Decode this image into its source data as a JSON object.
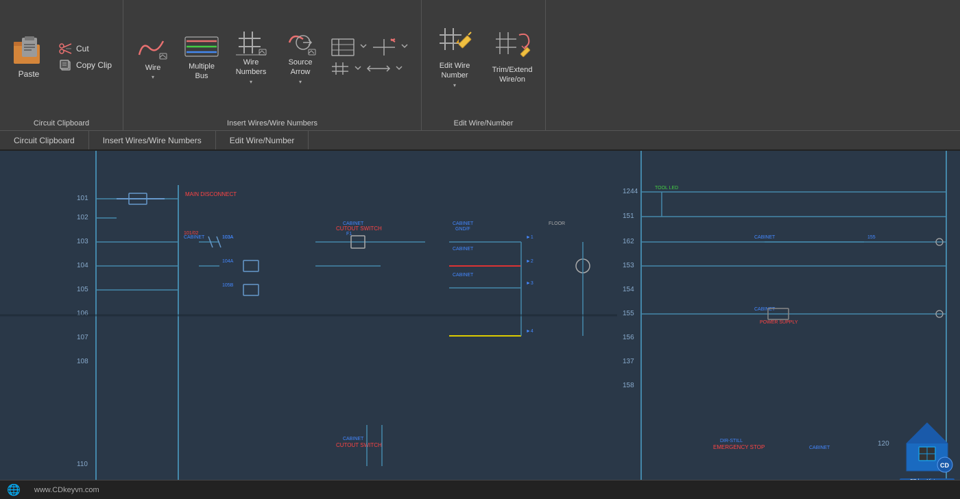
{
  "ribbon": {
    "sections": [
      {
        "id": "circuit-clipboard",
        "label": "Circuit Clipboard",
        "buttons": [
          {
            "id": "paste",
            "label": "Paste",
            "type": "large"
          },
          {
            "id": "cut",
            "label": "Cut",
            "type": "small"
          },
          {
            "id": "copy-clip",
            "label": "Copy Clip",
            "type": "small"
          }
        ]
      },
      {
        "id": "insert-wires",
        "label": "Insert Wires/Wire Numbers",
        "buttons": [
          {
            "id": "wire",
            "label": "Wire",
            "hasDropdown": true
          },
          {
            "id": "multiple-bus",
            "label": "Multiple\nBus",
            "hasDropdown": false
          },
          {
            "id": "wire-numbers",
            "label": "Wire\nNumbers",
            "hasDropdown": true
          },
          {
            "id": "source-arrow",
            "label": "Source\nArrow",
            "hasDropdown": true
          }
        ]
      },
      {
        "id": "edit-wire-num",
        "label": "Edit Wire/Number",
        "buttons": [
          {
            "id": "edit-wire-number",
            "label": "Edit Wire\nNumber",
            "hasDropdown": true
          },
          {
            "id": "trim",
            "label": "Trim/Extend\nWire/on",
            "hasDropdown": false
          }
        ]
      }
    ],
    "footer": {
      "items": [
        {
          "id": "circuit-clipboard-footer",
          "label": "Circuit Clipboard"
        },
        {
          "id": "insert-wires-footer",
          "label": "Insert Wires/Wire Numbers"
        },
        {
          "id": "edit-wire-footer",
          "label": "Edit Wire/Number"
        }
      ]
    }
  },
  "canvas": {
    "background": "#2a3a4a"
  },
  "statusbar": {
    "website": "www.CDkeyvn.com"
  }
}
